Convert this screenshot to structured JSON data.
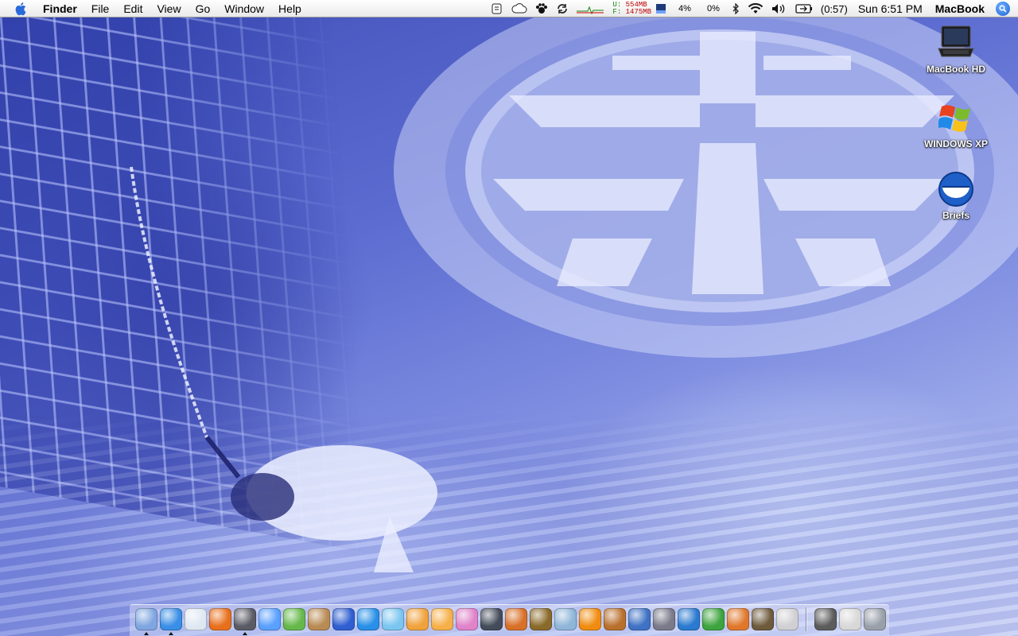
{
  "menubar": {
    "app_name": "Finder",
    "menus": [
      "File",
      "Edit",
      "View",
      "Go",
      "Window",
      "Help"
    ],
    "memory": {
      "used_label": "U:",
      "used_value": "554MB",
      "free_label": "F:",
      "free_value": "1475MB"
    },
    "cpu_a": "4%",
    "cpu_b": "0%",
    "battery_time": "(0:57)",
    "clock": "Sun 6:51 PM",
    "user": "MacBook"
  },
  "desktop_icons": [
    {
      "label": "MacBook HD",
      "icon": "hard-drive-icon"
    },
    {
      "label": "WINDOWS XP",
      "icon": "windows-logo-icon"
    },
    {
      "label": "Briefs",
      "icon": "briefs-app-icon"
    }
  ],
  "dock": {
    "apps": [
      {
        "name": "finder",
        "color": "#7fa6e0",
        "running": true
      },
      {
        "name": "safari",
        "color": "#3a8ee6",
        "running": true
      },
      {
        "name": "dashboard",
        "color": "#dfe8f2",
        "running": false
      },
      {
        "name": "firefox",
        "color": "#e8701c",
        "running": false
      },
      {
        "name": "mail",
        "color": "#5b5b66",
        "running": true
      },
      {
        "name": "ichat",
        "color": "#5aa0ff",
        "running": false
      },
      {
        "name": "itunes",
        "color": "#66b84a",
        "running": false
      },
      {
        "name": "iphoto",
        "color": "#b98b54",
        "running": false
      },
      {
        "name": "imovie",
        "color": "#2f5fd0",
        "running": false
      },
      {
        "name": "idvd",
        "color": "#2890e8",
        "running": false
      },
      {
        "name": "iweb",
        "color": "#7bc6f0",
        "running": false
      },
      {
        "name": "garageband",
        "color": "#f0a23c",
        "running": false
      },
      {
        "name": "flower-app",
        "color": "#f6b04a",
        "running": false
      },
      {
        "name": "butterfly-app",
        "color": "#e083c8",
        "running": false
      },
      {
        "name": "dvd-player",
        "color": "#444c5a",
        "running": false
      },
      {
        "name": "cinema-app",
        "color": "#d87028",
        "running": false
      },
      {
        "name": "pineapple-app",
        "color": "#8a6a2a",
        "running": false
      },
      {
        "name": "preview",
        "color": "#8fb6d8",
        "running": false
      },
      {
        "name": "vlc",
        "color": "#f08c10",
        "running": false
      },
      {
        "name": "photo-booth",
        "color": "#b8702c",
        "running": false
      },
      {
        "name": "keynote",
        "color": "#3f72c4",
        "running": false
      },
      {
        "name": "pen-app",
        "color": "#7a7a8a",
        "running": false
      },
      {
        "name": "word",
        "color": "#2a7ad0",
        "running": false
      },
      {
        "name": "excel",
        "color": "#3ea43e",
        "running": false
      },
      {
        "name": "powerpoint",
        "color": "#e0782c",
        "running": false
      },
      {
        "name": "tool-app",
        "color": "#6e5a3c",
        "running": false
      },
      {
        "name": "system-preferences",
        "color": "#d0d0d4",
        "running": false
      }
    ],
    "docs": [
      {
        "name": "folder-stack",
        "color": "#5c5c5c"
      },
      {
        "name": "documents",
        "color": "#d8d8d8"
      },
      {
        "name": "trash",
        "color": "#9aa0aa"
      }
    ]
  }
}
